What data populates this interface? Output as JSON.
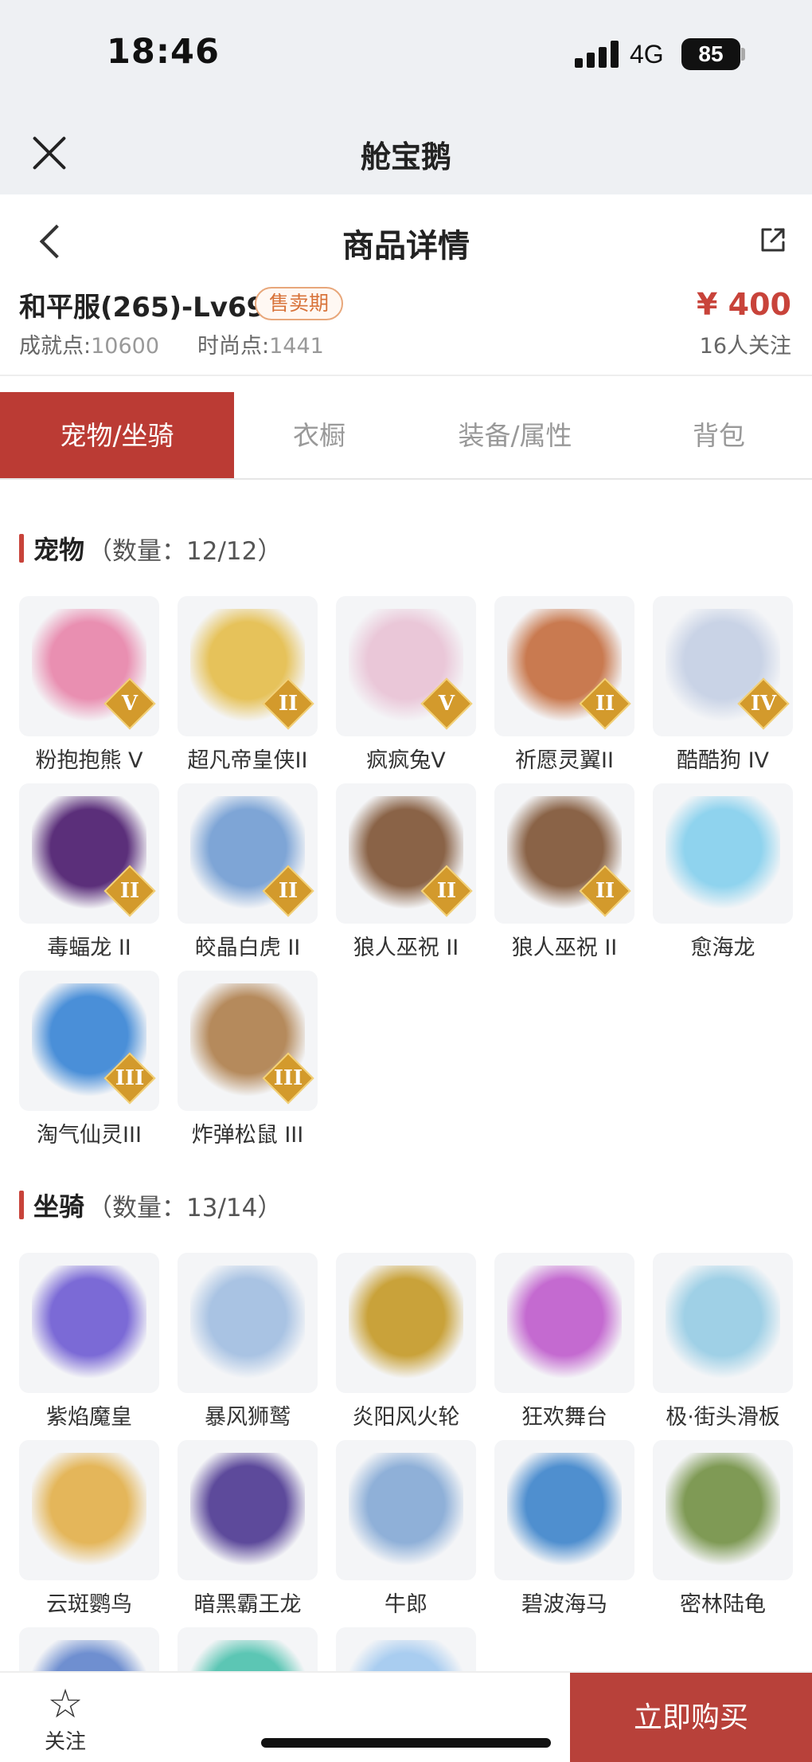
{
  "status_bar": {
    "time": "18:46",
    "network": "4G",
    "battery": "85"
  },
  "app_bar": {
    "title": "舱宝鹅"
  },
  "header": {
    "title": "商品详情"
  },
  "product": {
    "name": "和平服(265)-Lv69",
    "badge": "售卖期",
    "price": "¥ 400",
    "achievement_label": "成就点:",
    "achievement_value": "10600",
    "fashion_label": "时尚点:",
    "fashion_value": "1441",
    "followers": "16人关注"
  },
  "tabs": [
    {
      "label": "宠物/坐骑"
    },
    {
      "label": "衣橱"
    },
    {
      "label": "装备/属性"
    },
    {
      "label": "背包"
    }
  ],
  "pets": {
    "title": "宠物",
    "count": "（数量：12/12）",
    "items": [
      {
        "name": "粉抱抱熊 V",
        "tier": "V",
        "color": "#e98fb1"
      },
      {
        "name": "超凡帝皇侠II",
        "tier": "II",
        "color": "#e6c25a"
      },
      {
        "name": "疯疯兔V",
        "tier": "V",
        "color": "#eac7d8"
      },
      {
        "name": "祈愿灵翼II",
        "tier": "II",
        "color": "#c97a50"
      },
      {
        "name": "酷酷狗 IV",
        "tier": "IV",
        "color": "#c9d3e6"
      },
      {
        "name": "毒蝠龙 II",
        "tier": "II",
        "color": "#5b2f7a"
      },
      {
        "name": "皎晶白虎 II",
        "tier": "II",
        "color": "#7ea5d6"
      },
      {
        "name": "狼人巫祝 II",
        "tier": "II",
        "color": "#8a6347"
      },
      {
        "name": "狼人巫祝 II",
        "tier": "II",
        "color": "#8a6347"
      },
      {
        "name": "愈海龙",
        "tier": "",
        "color": "#8fd3ee"
      },
      {
        "name": "淘气仙灵III",
        "tier": "III",
        "color": "#4a8fd8"
      },
      {
        "name": "炸弹松鼠 III",
        "tier": "III",
        "color": "#b58a5c"
      }
    ]
  },
  "mounts": {
    "title": "坐骑",
    "count": "（数量：13/14）",
    "items": [
      {
        "name": "紫焰魔皇",
        "color": "#7b6ad6"
      },
      {
        "name": "暴风狮鹫",
        "color": "#a9c3e3"
      },
      {
        "name": "炎阳风火轮",
        "color": "#c9a23a"
      },
      {
        "name": "狂欢舞台",
        "color": "#c46ad0"
      },
      {
        "name": "极·街头滑板",
        "color": "#9fd0e6"
      },
      {
        "name": "云斑鹦鸟",
        "color": "#e4b65a"
      },
      {
        "name": "暗黑霸王龙",
        "color": "#5d4a9b"
      },
      {
        "name": "牛郎",
        "color": "#8fb0d8"
      },
      {
        "name": "碧波海马",
        "color": "#4f8fcf"
      },
      {
        "name": "密林陆龟",
        "color": "#7f9a55"
      },
      {
        "name": "",
        "color": "#6f8fd0"
      },
      {
        "name": "",
        "color": "#5cc6b4"
      },
      {
        "name": "",
        "color": "#a9cdf0"
      }
    ]
  },
  "bottom_bar": {
    "follow_label": "关注",
    "buy_label": "立即购买"
  },
  "colors": {
    "accent": "#bb3b34",
    "price": "#c8433a",
    "badge": "#d8733a"
  },
  "icons": {
    "close": "close-icon",
    "back": "back-icon",
    "share": "share-icon",
    "star": "star-icon"
  }
}
